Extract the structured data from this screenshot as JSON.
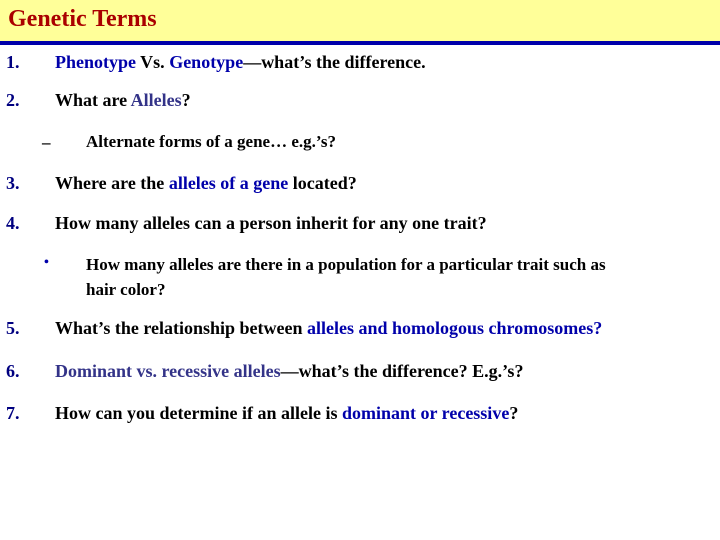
{
  "header": {
    "title": "Genetic Terms",
    "colors": {
      "background": "#FFFF99",
      "title": "#AA0000",
      "rule": "#0000AA"
    }
  },
  "colors": {
    "highlight": "#0000AA",
    "highlight_alt": "#333388",
    "text": "#000000",
    "number": "#000080"
  },
  "items": [
    {
      "number": "1.",
      "parts": [
        "Phenotype",
        " Vs. ",
        "Genotype",
        "—what’s the difference."
      ]
    },
    {
      "number": "2.",
      "parts": [
        "What are ",
        "Alleles",
        "?"
      ],
      "sub": {
        "marker": "–",
        "text": "Alternate forms of a gene…   e.g.’s?"
      }
    },
    {
      "number": "3.",
      "parts": [
        "Where are the ",
        "alleles of a gene",
        " located?"
      ]
    },
    {
      "number": "4.",
      "parts": [
        "How many alleles can a person inherit for any one trait?"
      ],
      "sub": {
        "marker": "•",
        "line1": "How many alleles are there in a population for a particular trait such as",
        "line2": "hair color?"
      }
    },
    {
      "number": "5.",
      "parts": [
        "What’s the relationship between ",
        "alleles",
        " and ",
        "homologous chromosomes",
        "?"
      ]
    },
    {
      "number": "6.",
      "parts": [
        "Dominant vs. recessive alleles",
        "—what’s the difference? E.g.’s?"
      ]
    },
    {
      "number": "7.",
      "parts": [
        "How can you determine if an allele is ",
        "dominant or recessive",
        "?"
      ]
    }
  ]
}
